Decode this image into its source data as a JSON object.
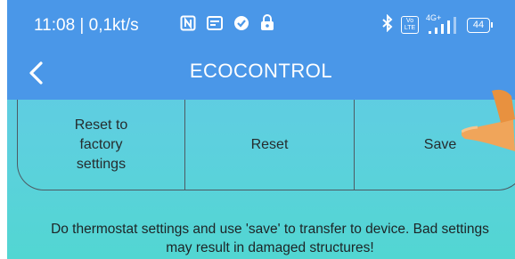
{
  "status_bar": {
    "time_and_speed": "11:08 | 0,1kt/s",
    "battery": "44",
    "network": "4G+",
    "volte": "Vo LTE",
    "icons": [
      "nfc-icon",
      "calendar-icon",
      "vpn-shield-icon",
      "lock-icon",
      "bluetooth-icon",
      "volte-icon",
      "signal-icon",
      "battery-icon"
    ]
  },
  "header": {
    "title": "ECOCONTROL",
    "back_icon": "chevron-left-icon"
  },
  "actions": {
    "factory_line1": "Reset to",
    "factory_line2": "factory",
    "factory_line3": "settings",
    "reset_label": "Reset",
    "save_label": "Save"
  },
  "warning": {
    "line1": "Do thermostat settings and use 'save' to transfer to device. Bad settings",
    "line2": "may result in damaged structures!"
  },
  "colors": {
    "header_bg": "#4a97e8",
    "body_bg": "#5dd0de",
    "border": "#4d5a63",
    "text": "#262c2e"
  }
}
